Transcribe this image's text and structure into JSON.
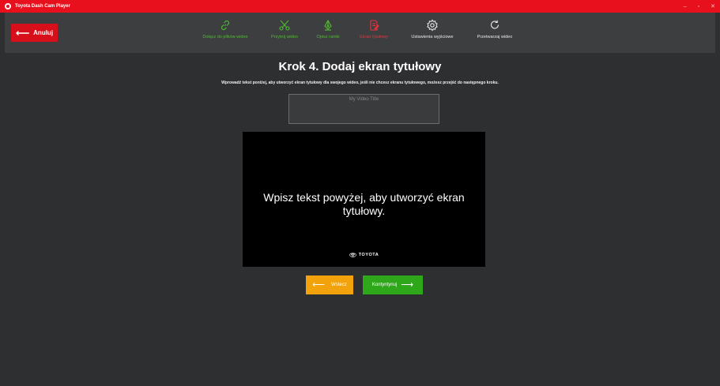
{
  "window": {
    "title": "Toyota Dash Cam Player",
    "controls": [
      "–",
      "▫",
      "✕"
    ]
  },
  "toolbar": {
    "back_label": "Anuluj",
    "steps": [
      {
        "label": "Dołącz do plików wideo",
        "state": "done",
        "icon": "link-icon"
      },
      {
        "label": "Przytnij wideo",
        "state": "done",
        "icon": "scissors-icon"
      },
      {
        "label": "Opisz ramki",
        "state": "done",
        "icon": "pen-nib-icon"
      },
      {
        "label": "Ekran tytułowy",
        "state": "current",
        "icon": "document-edit-icon"
      },
      {
        "label": "Ustawienia wyjściowe",
        "state": "todo",
        "icon": "settings-gear-icon"
      },
      {
        "label": "Przetwarzaj wideo",
        "state": "todo",
        "icon": "refresh-icon"
      }
    ]
  },
  "main": {
    "heading": "Krok 4. Dodaj ekran tytułowy",
    "subtext": "Wprowadź tekst poniżej, aby utworzyć ekran tytułowy dla swojego wideo, jeśli nie chcesz ekranu tytułowego, możesz przejść do następnego kroku.",
    "title_input": {
      "value": "",
      "placeholder": "My Video Title"
    },
    "preview": {
      "text": "Wpisz tekst powyżej, aby utworzyć ekran tytułowy.",
      "logo_text": "TOYOTA"
    },
    "prev_label": "Wstecz",
    "next_label": "Kontyntynuj"
  },
  "colors": {
    "brand_red": "#e8101c",
    "done_green": "#4ebd2e",
    "current_red": "#e8323c",
    "prev_orange": "#f2a20b",
    "next_green": "#2fa71a"
  }
}
